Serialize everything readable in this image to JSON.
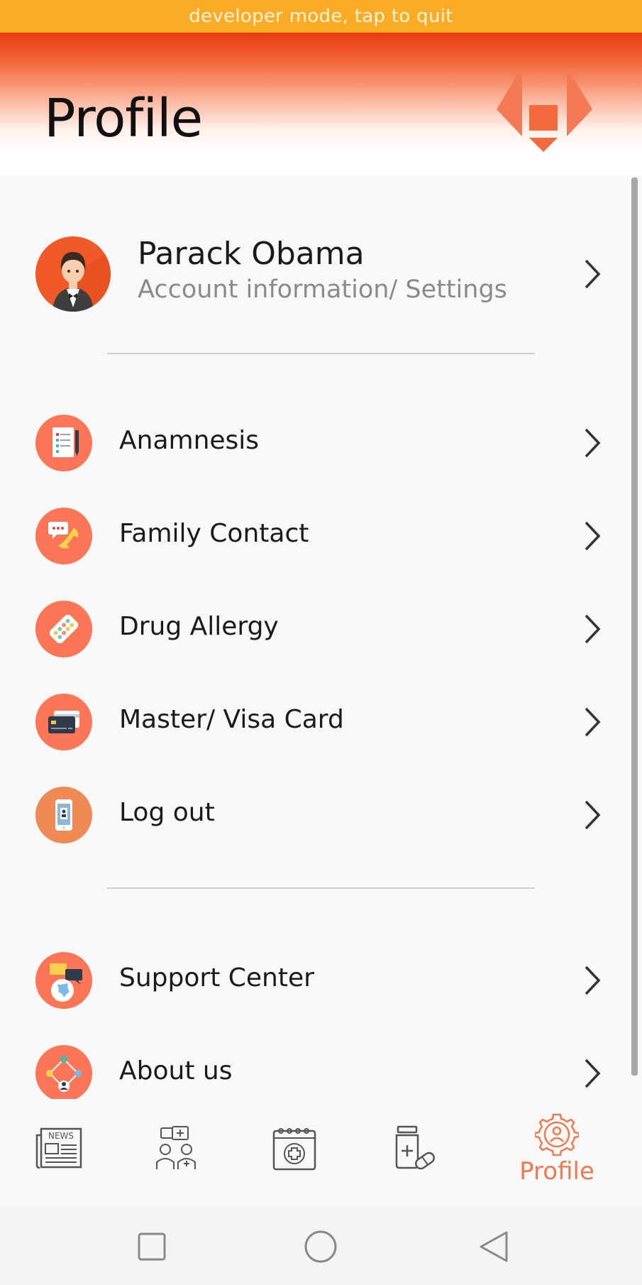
{
  "dev_banner": "developer mode, tap to quit",
  "header": {
    "title": "Profile"
  },
  "profile": {
    "name": "Parack Obama",
    "subtitle": "Account information/ Settings"
  },
  "menu_primary": [
    {
      "label": "Anamnesis",
      "icon": "medical-record-icon"
    },
    {
      "label": "Family Contact",
      "icon": "phone-chat-icon"
    },
    {
      "label": "Drug Allergy",
      "icon": "pill-pack-icon"
    },
    {
      "label": "Master/ Visa Card",
      "icon": "credit-card-icon"
    },
    {
      "label": "Log out",
      "icon": "phone-id-icon"
    }
  ],
  "menu_secondary": [
    {
      "label": "Support Center",
      "icon": "support-globe-icon"
    },
    {
      "label": "About us",
      "icon": "network-icon"
    }
  ],
  "bottom_nav": [
    {
      "icon": "news-icon",
      "badge_text": "NEWS",
      "label": ""
    },
    {
      "icon": "doctors-icon",
      "label": ""
    },
    {
      "icon": "calendar-medical-icon",
      "label": ""
    },
    {
      "icon": "medicine-icon",
      "label": ""
    },
    {
      "icon": "profile-gear-icon",
      "label": "Profile",
      "active": true
    }
  ],
  "colors": {
    "accent": "#f07a50",
    "banner": "#fbac24",
    "icon_bg": "#fa7657",
    "header_top": "#ea3a10"
  }
}
